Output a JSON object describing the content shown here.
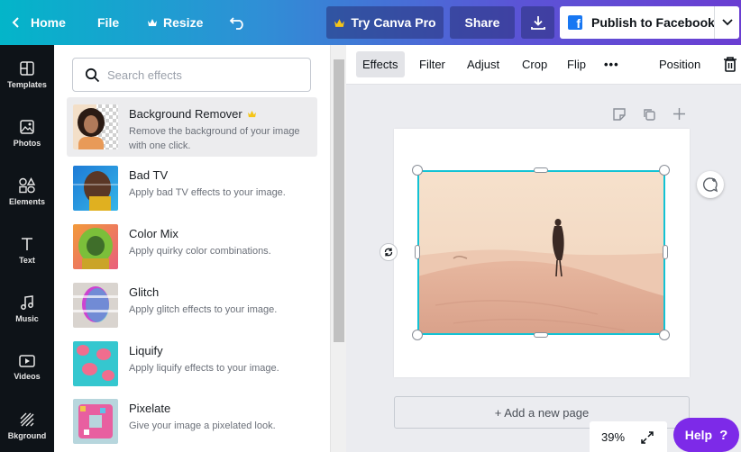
{
  "topbar": {
    "home_label": "Home",
    "file_label": "File",
    "resize_label": "Resize",
    "try_pro_label": "Try Canva Pro",
    "share_label": "Share",
    "publish_label": "Publish to Facebook"
  },
  "rail": {
    "items": [
      {
        "label": "Templates",
        "icon": "templates-icon"
      },
      {
        "label": "Photos",
        "icon": "photos-icon"
      },
      {
        "label": "Elements",
        "icon": "elements-icon"
      },
      {
        "label": "Text",
        "icon": "text-icon"
      },
      {
        "label": "Music",
        "icon": "music-icon"
      },
      {
        "label": "Videos",
        "icon": "videos-icon"
      },
      {
        "label": "Bkground",
        "icon": "background-icon"
      }
    ]
  },
  "effects_panel": {
    "search_placeholder": "Search effects",
    "items": [
      {
        "title": "Background Remover",
        "description": "Remove the background of your image with one click.",
        "pro": true,
        "selected": true
      },
      {
        "title": "Bad TV",
        "description": "Apply bad TV effects to your image."
      },
      {
        "title": "Color Mix",
        "description": "Apply quirky color combinations."
      },
      {
        "title": "Glitch",
        "description": "Apply glitch effects to your image."
      },
      {
        "title": "Liquify",
        "description": "Apply liquify effects to your image."
      },
      {
        "title": "Pixelate",
        "description": "Give your image a pixelated look."
      }
    ]
  },
  "toolbar": {
    "effects_label": "Effects",
    "filter_label": "Filter",
    "adjust_label": "Adjust",
    "crop_label": "Crop",
    "flip_label": "Flip",
    "more_label": "•••",
    "position_label": "Position"
  },
  "canvas": {
    "add_page_label": "+ Add a new page",
    "zoom_label": "39%"
  },
  "help_label": "Help",
  "help_mark": "?",
  "colors": {
    "accent": "#13c2d4",
    "help": "#7d2ae8",
    "pro_crown": "#f5c518",
    "facebook": "#1877f2"
  }
}
